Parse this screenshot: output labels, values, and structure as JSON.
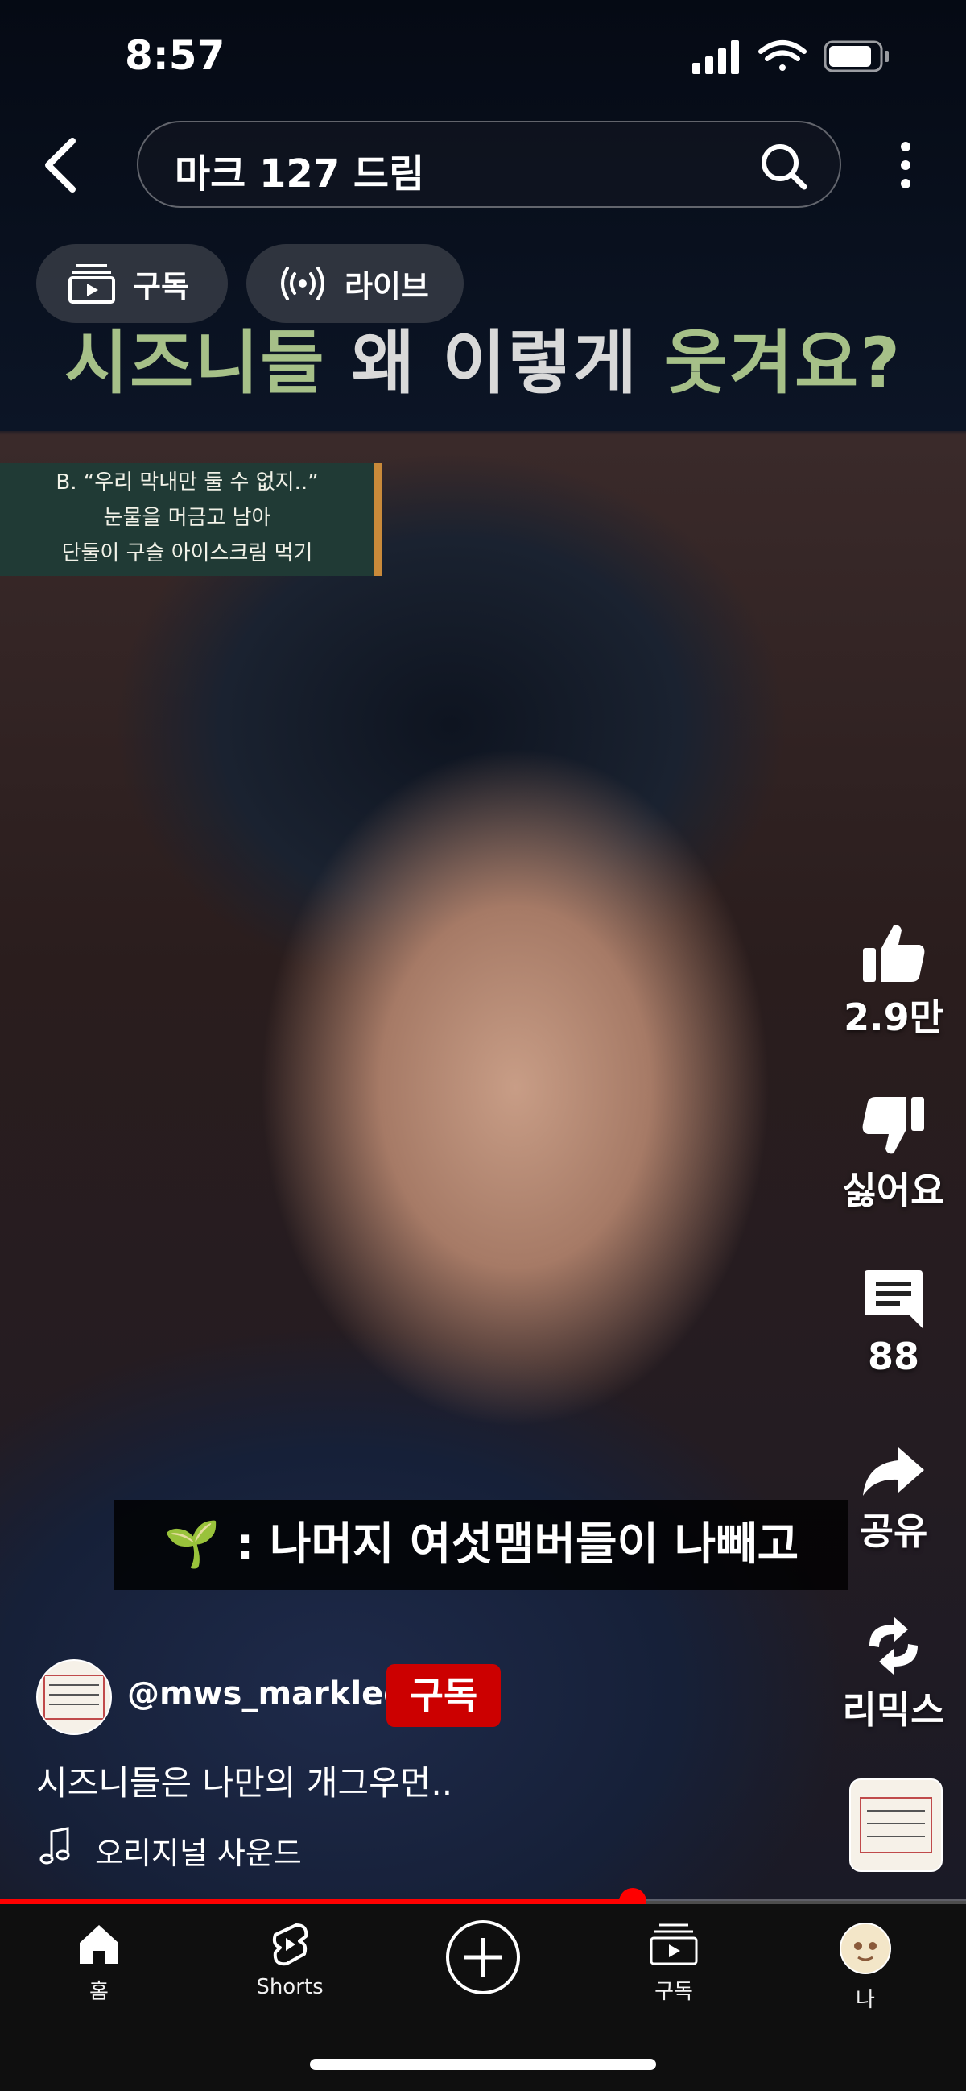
{
  "status_bar": {
    "time": "8:57"
  },
  "search": {
    "query": "마크 127 드림"
  },
  "chips": {
    "subscriptions": "구독",
    "live": "라이브"
  },
  "video": {
    "headline_part1": "시즈니들",
    "headline_part2": " 왜 이렇게 ",
    "headline_part3": "웃겨요?",
    "chalk_lines": [
      "B. “우리 막내만 둘 수 없지..”",
      "눈물을 머금고 남아",
      "단둘이 구슬 아이스크림 먹기"
    ],
    "subtitle": "🌱 : 나머지 여섯맴버들이 나빼고"
  },
  "actions": {
    "like_count": "2.9만",
    "dislike_label": "싫어요",
    "comment_count": "88",
    "share_label": "공유",
    "remix_label": "리믹스"
  },
  "channel": {
    "handle": "@mws_marklee",
    "subscribe_label": "구독",
    "caption": "시즈니들은 나만의 개그우먼..",
    "sound": "오리지널 사운드",
    "avatar_text": "마크 홈 오구오 여기 둘 빵 짤"
  },
  "progress": {
    "fraction": 0.655
  },
  "nav": {
    "home": "홈",
    "shorts": "Shorts",
    "subscriptions": "구독",
    "me": "나"
  },
  "colors": {
    "accent": "#ff0000",
    "subscribe": "#cc0000"
  }
}
